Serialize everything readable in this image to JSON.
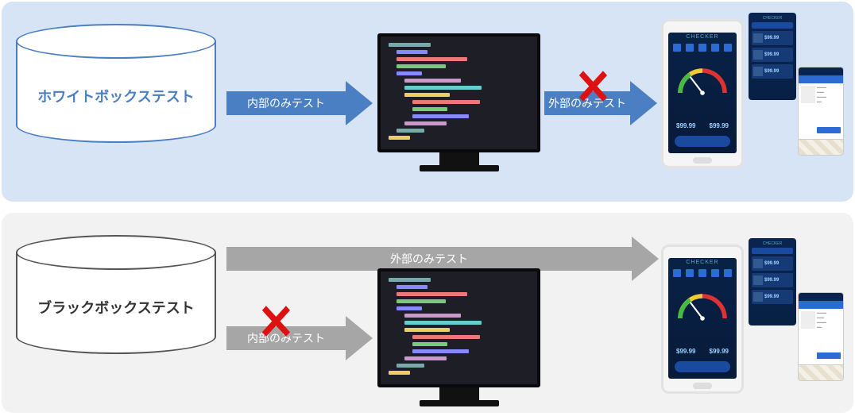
{
  "rows": {
    "whitebox": {
      "title": "ホワイトボックステスト",
      "arrow_internal": "内部のみテスト",
      "arrow_external": "外部のみテスト",
      "internal_blocked": false,
      "external_blocked": true
    },
    "blackbox": {
      "title": "ブラックボックステスト",
      "arrow_internal": "内部のみテスト",
      "arrow_external": "外部のみテスト",
      "internal_blocked": true,
      "external_blocked": false
    }
  },
  "phone": {
    "brand": "CHECKER",
    "stat_left": "$99.99",
    "stat_right": "$99.99",
    "list_price": "$99.99"
  },
  "colors": {
    "accent_blue": "#4a7fc4",
    "accent_gray": "#a6a6a6",
    "cross_red": "#d11"
  }
}
